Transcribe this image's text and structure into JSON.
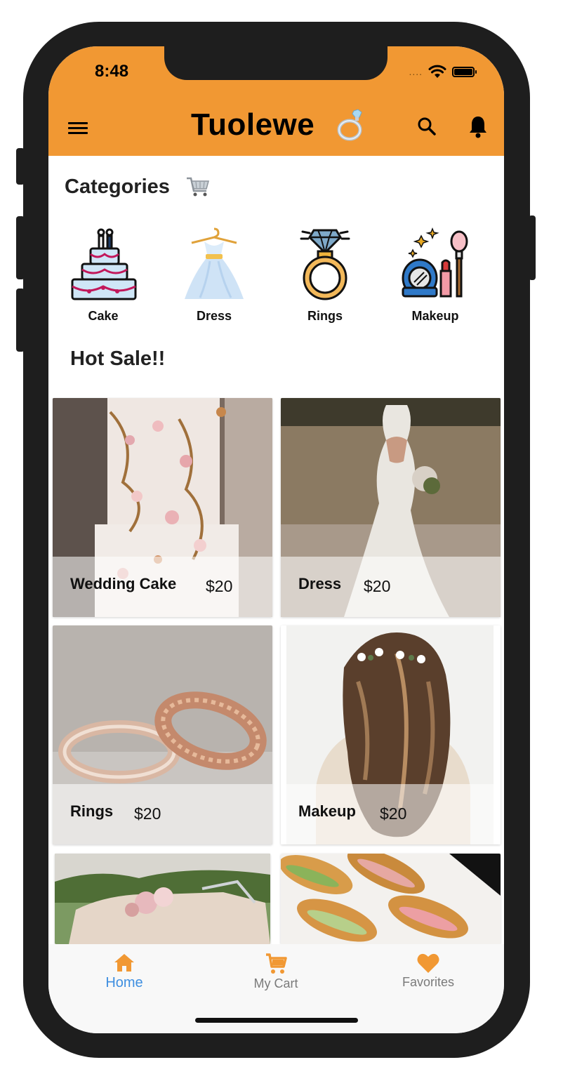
{
  "status_bar": {
    "time": "8:48",
    "signal": "....",
    "icons": [
      "wifi-icon",
      "battery-icon"
    ]
  },
  "app_bar": {
    "title": "Tuolewe",
    "title_emoji": "ring-icon",
    "icons": [
      "menu-icon",
      "search-icon",
      "bell-icon"
    ]
  },
  "categories": {
    "title": "Categories",
    "title_emoji": "shopping-cart-icon",
    "items": [
      {
        "label": "Cake",
        "icon": "cake-icon"
      },
      {
        "label": "Dress",
        "icon": "dress-icon"
      },
      {
        "label": "Rings",
        "icon": "ring-icon"
      },
      {
        "label": "Makeup",
        "icon": "makeup-icon"
      }
    ]
  },
  "hot_sale": {
    "title": "Hot Sale!!",
    "items": [
      {
        "name": "Wedding Cake",
        "price": "$20",
        "image": "wedding-cake-photo"
      },
      {
        "name": "Dress",
        "price": "$20",
        "image": "wedding-dress-photo"
      },
      {
        "name": "Rings",
        "price": "$20",
        "image": "wedding-rings-photo"
      },
      {
        "name": "Makeup",
        "price": "$20",
        "image": "bridal-hair-photo"
      },
      {
        "name": "",
        "price": "",
        "image": "wedding-car-photo"
      },
      {
        "name": "",
        "price": "",
        "image": "croissant-sandwich-photo"
      }
    ]
  },
  "bottom_nav": {
    "items": [
      {
        "label": "Home",
        "icon": "home-icon",
        "active": true
      },
      {
        "label": "My Cart",
        "icon": "cart-icon",
        "active": false
      },
      {
        "label": "Favorites",
        "icon": "heart-icon",
        "active": false
      }
    ]
  },
  "colors": {
    "primary": "#f19833",
    "active_nav": "#3f8fe0",
    "inactive_nav": "#7a7a7a",
    "frame": "#1e1e1e"
  }
}
